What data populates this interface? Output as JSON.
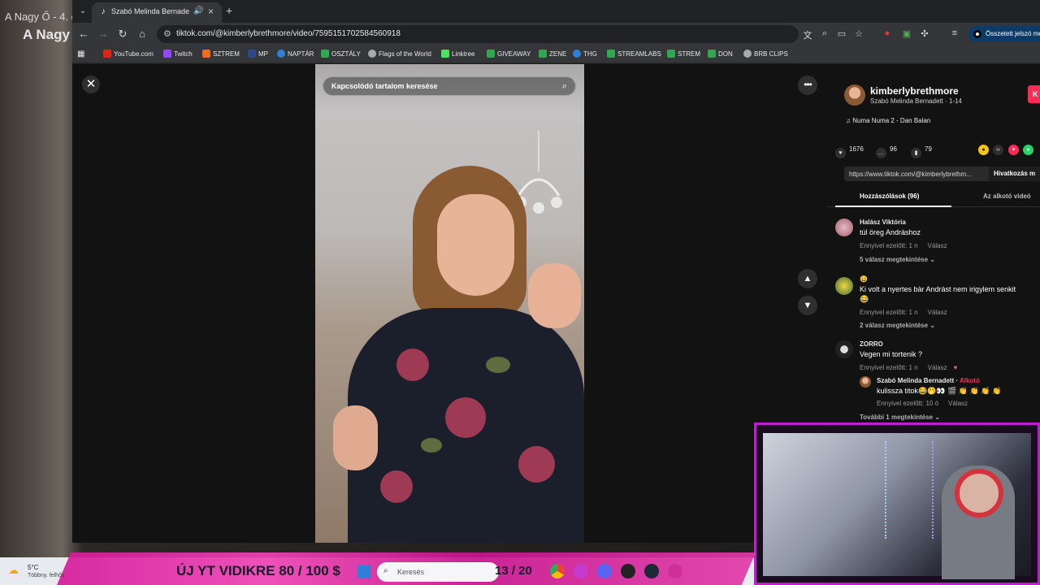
{
  "stream_bg": {
    "title_top": "A Nagy Ő - 4. é",
    "title_large": "A Nagy"
  },
  "browser": {
    "tab": {
      "title": "Szabó Melinda Bernadett (@"
    },
    "url": "tiktok.com/@kimberlybrethmore/video/7595151702584560918",
    "password_button": "Összetett jelszó me",
    "bookmarks": [
      "YouTube.com",
      "Twitch",
      "SZTREM",
      "MP",
      "NAPTÁR",
      "OSZTÁLY",
      "Flags of the World",
      "Linktree",
      "GIVEAWAY",
      "ZENE",
      "THG",
      "STREAMLABS",
      "STREM",
      "DON",
      "BRB CLIPS"
    ]
  },
  "tiktok": {
    "search_placeholder": "Kapcsolódó tartalom keresése",
    "author": {
      "handle": "kimberlybrethmore",
      "subtitle": "Szabó Melinda Bernadett · 1-14",
      "follow": "K"
    },
    "music": "Numa Numa 2 - Dan Balan",
    "stats": {
      "likes": "1676",
      "comments": "96",
      "saves": "79"
    },
    "link": "https://www.tiktok.com/@kimberlybrethm...",
    "copy_link": "Hivatkozás m",
    "tabs": [
      "Hozzászólások (96)",
      "Az alkotó videó"
    ],
    "comments": [
      {
        "name": "Halász Viktória",
        "text": "túl öreg Andráshoz",
        "time": "Ennyivel ezelőtt: 1 n",
        "reply": "Válasz",
        "more": "5 válasz megtekintése ⌄"
      },
      {
        "name": "😀",
        "text": "Ki volt a nyertes bàr Andràst nem irigylem senkit",
        "text2": "😂",
        "time": "Ennyivel ezelőtt: 1 n",
        "reply": "Válasz",
        "more": "2 válasz megtekintése ⌄"
      },
      {
        "name": "ZORRO",
        "text": "Vegen mi tortenik ?",
        "time": "Ennyivel ezelőtt: 1 n",
        "reply": "Válasz",
        "more": "További 1 megtekintése ⌄"
      }
    ],
    "reply": {
      "name": "Szabó Melinda Bernadett",
      "creator": "Alkotó",
      "text": "kulissza titok😂🤭👀 🎬 👏 👏 👏 👏",
      "time": "Ennyivel ezelőtt: 10 ó",
      "reply": "Válasz"
    }
  },
  "taskbar": {
    "weather_temp": "5°C",
    "weather_desc": "Többny. felhős",
    "goal": "ÚJ YT VIDIKRE  80 / 100 $",
    "search": "Keresés",
    "counter": "13 / 20"
  },
  "colors": {
    "tiktok_red": "#fe2c55",
    "overlay_pink": "#d6199a",
    "cam_border": "#c21bd1"
  }
}
